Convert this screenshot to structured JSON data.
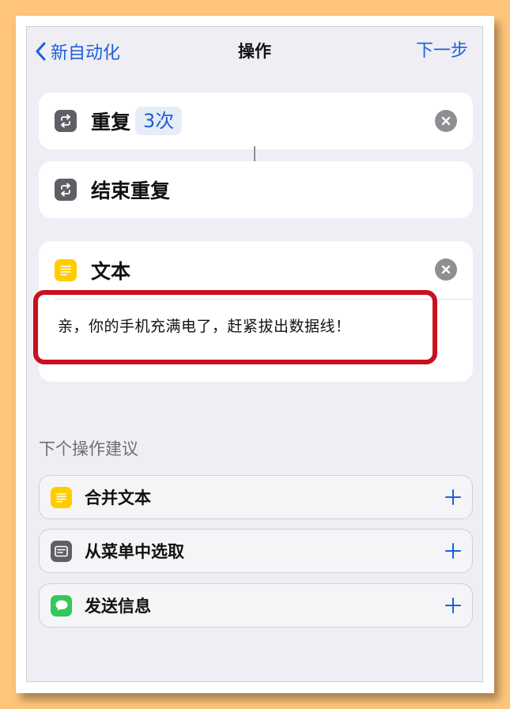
{
  "nav": {
    "back_label": "新自动化",
    "title": "操作",
    "next_label": "下一步"
  },
  "actions": {
    "repeat": {
      "label": "重复",
      "param": "3次"
    },
    "end_repeat": {
      "label": "结束重复"
    },
    "text": {
      "label": "文本",
      "content": "亲，你的手机充满电了，赶紧拔出数据线！"
    }
  },
  "suggestions": {
    "title": "下个操作建议",
    "items": [
      {
        "label": "合并文本",
        "icon": "text-icon"
      },
      {
        "label": "从菜单中选取",
        "icon": "menu-icon"
      },
      {
        "label": "发送信息",
        "icon": "messages-icon"
      }
    ]
  },
  "colors": {
    "accent": "#1C5FD8",
    "highlight": "#C8101E",
    "background": "#FFC57A"
  }
}
